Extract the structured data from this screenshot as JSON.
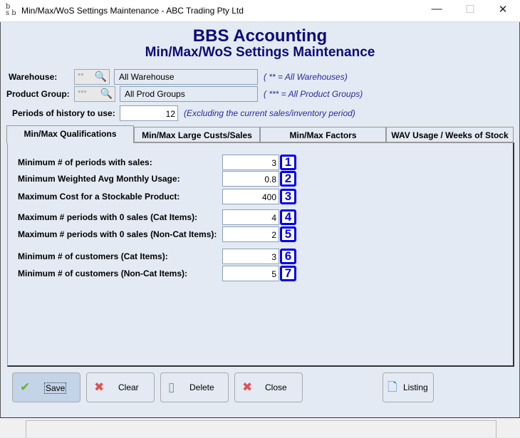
{
  "window": {
    "title": "Min/Max/WoS Settings Maintenance - ABC Trading Pty Ltd",
    "logo": "bbs",
    "minimize": "—",
    "maximize": "☐",
    "close": "✕"
  },
  "header": {
    "app": "BBS Accounting",
    "subtitle": "Min/Max/WoS Settings Maintenance"
  },
  "filters": {
    "warehouse": {
      "label": "Warehouse:",
      "code": "**",
      "description": "All Warehouse",
      "note": "( ** = All Warehouses)"
    },
    "product_group": {
      "label": "Product Group:",
      "code": "***",
      "description": "All Prod Groups",
      "note": "( *** = All Product Groups)"
    },
    "periods": {
      "label": "Periods of history to use:",
      "value": "12",
      "note": "(Excluding the current sales/inventory period)"
    }
  },
  "tabs": [
    {
      "label": "Min/Max Qualifications",
      "active": true
    },
    {
      "label": "Min/Max Large Custs/Sales"
    },
    {
      "label": "Min/Max Factors"
    },
    {
      "label": "WAV Usage / Weeks of Stock"
    }
  ],
  "fields": [
    {
      "label": "Minimum # of periods with sales:",
      "value": "3",
      "badge": "1"
    },
    {
      "label": "Minimum Weighted Avg Monthly Usage:",
      "value": "0.8",
      "badge": "2"
    },
    {
      "label": "Maximum Cost for a Stockable Product:",
      "value": "400",
      "badge": "3"
    },
    {
      "label": "Maximum # periods with 0 sales (Cat Items):",
      "value": "4",
      "badge": "4"
    },
    {
      "label": "Maximum # periods with 0 sales (Non-Cat Items):",
      "value": "2",
      "badge": "5"
    },
    {
      "label": "Minimum # of customers (Cat Items):",
      "value": "3",
      "badge": "6"
    },
    {
      "label": "Minimum # of customers (Non-Cat Items):",
      "value": "5",
      "badge": "7"
    }
  ],
  "buttons": {
    "save": "Save",
    "clear": "Clear",
    "delete": "Delete",
    "close": "Close",
    "listing": "Listing"
  },
  "colors": {
    "title": "#0b0b7a",
    "badge": "#0000ee",
    "background": "#e3eaf3"
  }
}
